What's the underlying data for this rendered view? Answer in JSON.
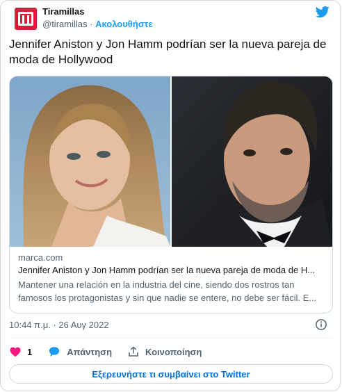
{
  "account": {
    "name": "Tiramillas",
    "handle": "@tiramillas",
    "separator": "·",
    "follow_label": "Ακολουθήστε",
    "avatar_icon": "tiramillas-logo-icon",
    "brand_color": "#d91e3b"
  },
  "tweet": {
    "text": "Jennifer Aniston y Jon Hamm podrían ser la nueva pareja de moda de Hollywood",
    "timestamp": "10:44 π.μ. · 26 Αυγ 2022"
  },
  "card": {
    "domain": "marca.com",
    "title": "Jennifer Aniston y Jon Hamm podrían ser la nueva pareja de moda de H...",
    "description": "Mantener una relación en la industria del cine, siendo dos rostros tan famosos los protagonistas y sin que nadie se entere, no debe ser fácil. E..."
  },
  "actions": {
    "like_count": "1",
    "reply_label": "Απάντηση",
    "share_label": "Κοινοποίηση"
  },
  "explore_label": "Εξερευνήστε τι συμβαίνει στο Twitter",
  "colors": {
    "twitter_blue": "#1d9bf0",
    "like_red": "#f91880",
    "link_blue": "#006fd6"
  }
}
